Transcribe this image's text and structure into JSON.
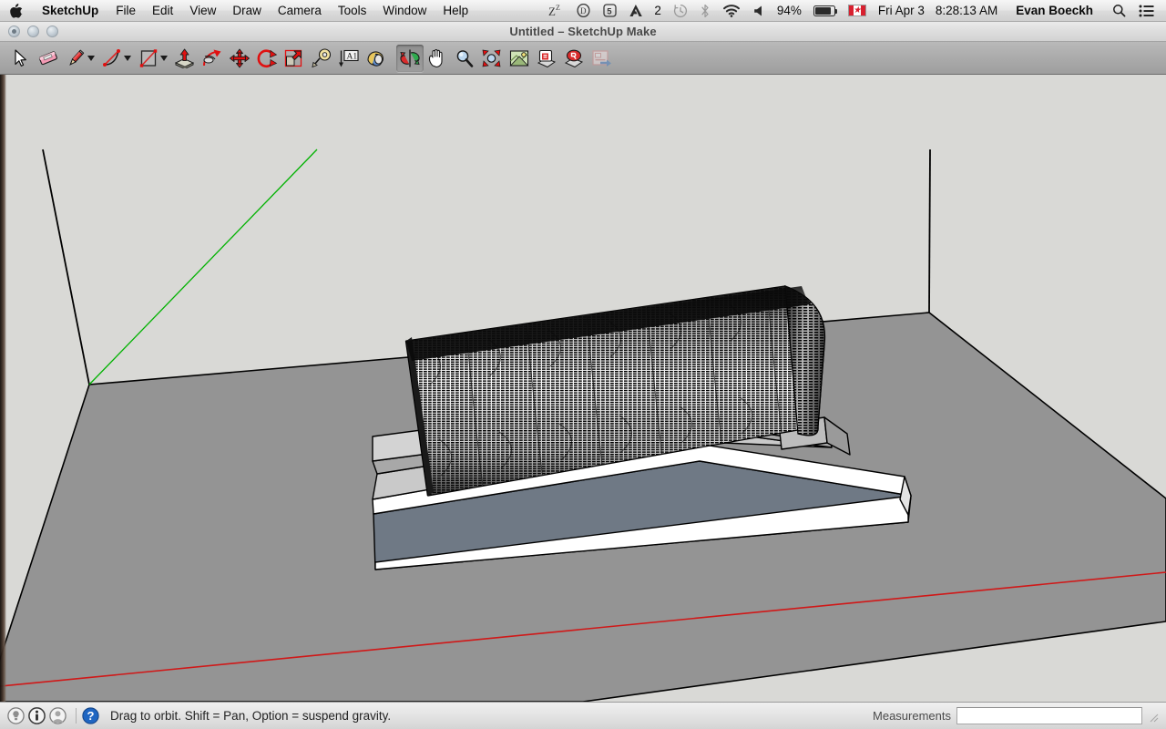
{
  "menubar": {
    "apple_icon": "apple-logo-icon",
    "items": [
      {
        "label": "SketchUp",
        "bold": true
      },
      {
        "label": "File"
      },
      {
        "label": "Edit"
      },
      {
        "label": "View"
      },
      {
        "label": "Draw"
      },
      {
        "label": "Camera"
      },
      {
        "label": "Tools"
      },
      {
        "label": "Window"
      },
      {
        "label": "Help"
      }
    ],
    "status_icons": [
      {
        "name": "caffeine-zzz-icon",
        "text": "Z"
      },
      {
        "name": "dropbox-icon",
        "text": "D"
      },
      {
        "name": "scroll-reverser-icon",
        "text": "S"
      },
      {
        "name": "adobe-creative-cloud-icon",
        "text": "A"
      },
      {
        "name": "adobe-badge-count",
        "text": "2"
      },
      {
        "name": "time-machine-icon",
        "text": ""
      },
      {
        "name": "bluetooth-icon",
        "text": ""
      },
      {
        "name": "wifi-icon",
        "text": ""
      },
      {
        "name": "volume-icon",
        "text": ""
      }
    ],
    "battery_percent": "94%",
    "battery_fill": 80,
    "input_flag": "CA",
    "date": "Fri Apr 3",
    "time": "8:28:13 AM",
    "user": "Evan Boeckh",
    "search_icon": "spotlight-search-icon",
    "notification_icon": "notification-center-icon"
  },
  "window": {
    "title": "Untitled – SketchUp Make",
    "buttons": [
      {
        "name": "close-button"
      },
      {
        "name": "minimize-button"
      },
      {
        "name": "zoom-button"
      }
    ]
  },
  "toolbar": {
    "tools": [
      {
        "name": "select-tool",
        "label": "Select",
        "caret": false,
        "active": false
      },
      {
        "name": "eraser-tool",
        "label": "Eraser",
        "caret": false,
        "active": false
      },
      {
        "name": "line-tool",
        "label": "Line",
        "caret": true,
        "active": false
      },
      {
        "name": "arc-tool",
        "label": "Arc",
        "caret": true,
        "active": false
      },
      {
        "name": "rectangle-tool",
        "label": "Rectangle",
        "caret": true,
        "active": false
      },
      {
        "name": "pushpull-tool",
        "label": "Push/Pull",
        "caret": false,
        "active": false
      },
      {
        "name": "followme-tool",
        "label": "Follow Me",
        "caret": false,
        "active": false
      },
      {
        "name": "move-tool",
        "label": "Move",
        "caret": false,
        "active": false
      },
      {
        "name": "rotate-tool",
        "label": "Rotate",
        "caret": false,
        "active": false
      },
      {
        "name": "scale-tool",
        "label": "Scale",
        "caret": false,
        "active": false
      },
      {
        "name": "tape-measure-tool",
        "label": "Tape Measure",
        "caret": false,
        "active": false
      },
      {
        "name": "text-tool",
        "label": "Text",
        "caret": false,
        "active": false
      },
      {
        "name": "paint-bucket-tool",
        "label": "Paint Bucket",
        "caret": false,
        "active": false
      },
      {
        "name": "orbit-tool",
        "label": "Orbit",
        "caret": false,
        "active": true
      },
      {
        "name": "pan-tool",
        "label": "Pan",
        "caret": false,
        "active": false
      },
      {
        "name": "zoom-tool",
        "label": "Zoom",
        "caret": false,
        "active": false
      },
      {
        "name": "zoom-extents-tool",
        "label": "Zoom Extents",
        "caret": false,
        "active": false
      },
      {
        "name": "previous-view-tool",
        "label": "Previous View",
        "caret": false,
        "active": false
      },
      {
        "name": "get-models-tool",
        "label": "3D Warehouse – Get Models",
        "caret": false,
        "active": false
      },
      {
        "name": "share-model-tool",
        "label": "3D Warehouse – Share Model",
        "caret": false,
        "active": false
      },
      {
        "name": "layout-tool",
        "label": "Send to LayOut",
        "caret": false,
        "active": false,
        "dim": true
      }
    ]
  },
  "statusbar": {
    "icons": [
      {
        "name": "tip-lightbulb-icon"
      },
      {
        "name": "info-icon"
      },
      {
        "name": "account-person-icon"
      },
      {
        "name": "help-question-icon"
      }
    ],
    "message": "Drag to orbit. Shift = Pan, Option = suspend gravity.",
    "measurements_label": "Measurements",
    "measurements_value": "",
    "measurements_placeholder": ""
  },
  "viewport": {
    "background_color": "#d9d9d6",
    "ground_color": "#949494",
    "axis_green_color": "#00b200",
    "axis_red_color": "#d01818",
    "edge_color": "#000000",
    "slab_white": "#ffffff",
    "slab_light": "#c9c9c9",
    "slab_mid": "#a8a8a8",
    "slab_blue_gray": "#6f7985",
    "cylinder_stripe_color": "#000000",
    "model_description": "Tilted striped cylinder resting on layered ramp slabs over a large ground plane"
  }
}
